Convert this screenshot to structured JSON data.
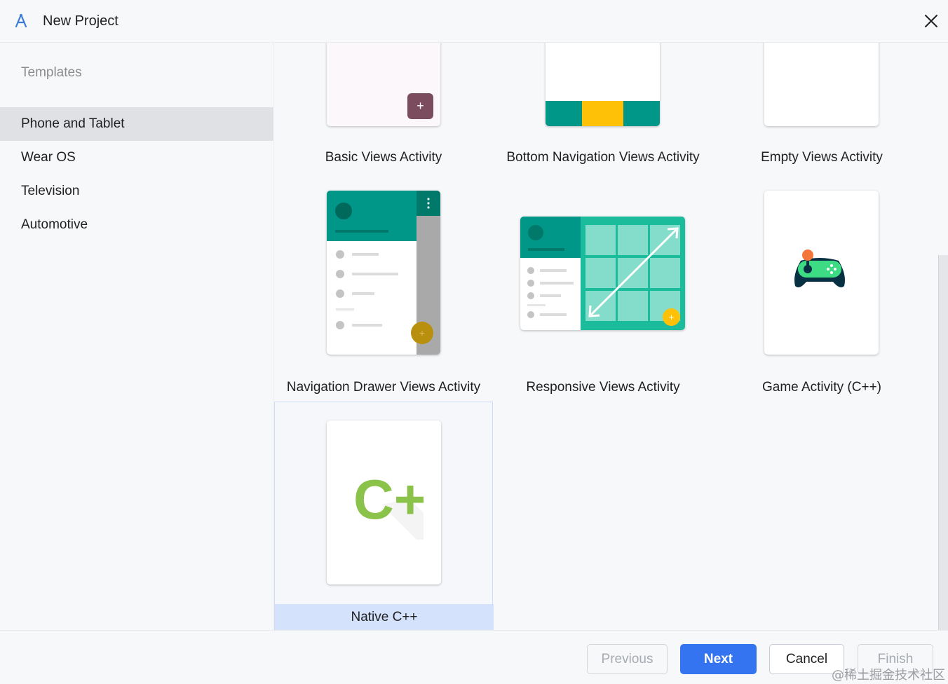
{
  "window": {
    "title": "New Project"
  },
  "sidebar": {
    "header": "Templates",
    "items": [
      {
        "label": "Phone and Tablet",
        "selected": true
      },
      {
        "label": "Wear OS"
      },
      {
        "label": "Television"
      },
      {
        "label": "Automotive"
      }
    ]
  },
  "templates": [
    {
      "label": "Basic Views Activity"
    },
    {
      "label": "Bottom Navigation Views Activity"
    },
    {
      "label": "Empty Views Activity"
    },
    {
      "label": "Navigation Drawer Views Activity"
    },
    {
      "label": "Responsive Views Activity"
    },
    {
      "label": "Game Activity (C++)"
    },
    {
      "label": "Native C++",
      "selected": true
    }
  ],
  "preview_text": {
    "cpp_logo": "C++",
    "fab_plus": "+"
  },
  "footer": {
    "previous": "Previous",
    "next": "Next",
    "cancel": "Cancel",
    "finish": "Finish"
  },
  "watermark": "@稀土掘金技术社区",
  "colors": {
    "accent": "#3574f0",
    "teal": "#009688",
    "amber": "#ffc107",
    "selected_item": "#d4e2fc",
    "cpp_green": "#8bc34a"
  }
}
